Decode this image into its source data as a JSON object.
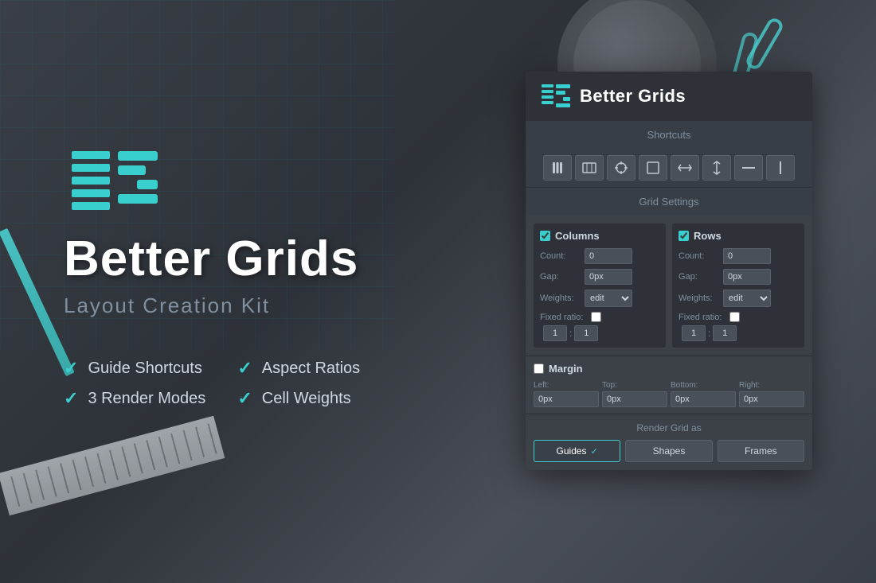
{
  "app": {
    "name": "Better Grids",
    "subtitle": "Layout Creation Kit"
  },
  "features": [
    {
      "label": "Guide Shortcuts"
    },
    {
      "label": "Aspect Ratios"
    },
    {
      "label": "3 Render Modes"
    },
    {
      "label": "Cell Weights"
    }
  ],
  "panel": {
    "title": "Better Grids",
    "sections": {
      "shortcuts": {
        "label": "Shortcuts",
        "icons": [
          "column-icon",
          "page-icon",
          "crosshair-icon",
          "square-icon",
          "resize-h-icon",
          "resize-v-icon",
          "minus-icon",
          "line-icon"
        ]
      },
      "gridSettings": {
        "label": "Grid Settings",
        "columns": {
          "enabled": true,
          "label": "Columns",
          "count_label": "Count:",
          "count_value": "0",
          "gap_label": "Gap:",
          "gap_value": "0px",
          "weights_label": "Weights:",
          "weights_value": "edit",
          "fixed_ratio_label": "Fixed ratio:",
          "ratio_val1": "1",
          "ratio_val2": "1"
        },
        "rows": {
          "enabled": true,
          "label": "Rows",
          "count_label": "Count:",
          "count_value": "0",
          "gap_label": "Gap:",
          "gap_value": "0px",
          "weights_label": "Weights:",
          "weights_value": "edit",
          "fixed_ratio_label": "Fixed ratio:",
          "ratio_val1": "1",
          "ratio_val2": "1"
        }
      },
      "margin": {
        "label": "Margin",
        "enabled": false,
        "left_label": "Left:",
        "left_value": "0px",
        "top_label": "Top:",
        "top_value": "0px",
        "bottom_label": "Bottom:",
        "bottom_value": "0px",
        "right_label": "Right:",
        "right_value": "0px"
      },
      "render": {
        "label": "Render Grid as",
        "buttons": [
          {
            "label": "Guides",
            "active": true
          },
          {
            "label": "Shapes",
            "active": false
          },
          {
            "label": "Frames",
            "active": false
          }
        ]
      }
    }
  },
  "colors": {
    "accent": "#3acfcf",
    "panel_bg": "#3c4148",
    "panel_dark": "#2e3238",
    "text_primary": "#ffffff",
    "text_secondary": "#8090a0"
  }
}
